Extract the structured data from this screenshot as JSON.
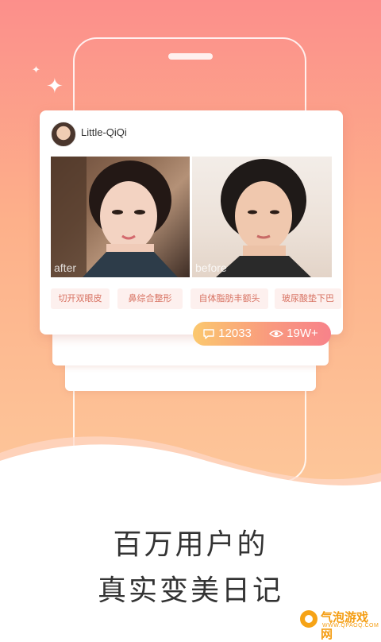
{
  "user": {
    "name": "Little-QiQi"
  },
  "photos": {
    "after_label": "after",
    "before_label": "before"
  },
  "tags": [
    "切开双眼皮",
    "鼻综合整形",
    "自体脂肪丰额头",
    "玻尿酸垫下巴"
  ],
  "stats": {
    "comments": "12033",
    "views": "19W+"
  },
  "headline": {
    "line1": "百万用户的",
    "line2": "真实变美日记"
  },
  "watermark": {
    "name": "气泡游戏网",
    "url": "WWW.QPAOQ.COM"
  },
  "colors": {
    "gradient_top": "#fc8f8b",
    "gradient_bottom": "#fdc79a",
    "tag_text": "#d87262",
    "tag_bg": "#fdf0ee"
  }
}
